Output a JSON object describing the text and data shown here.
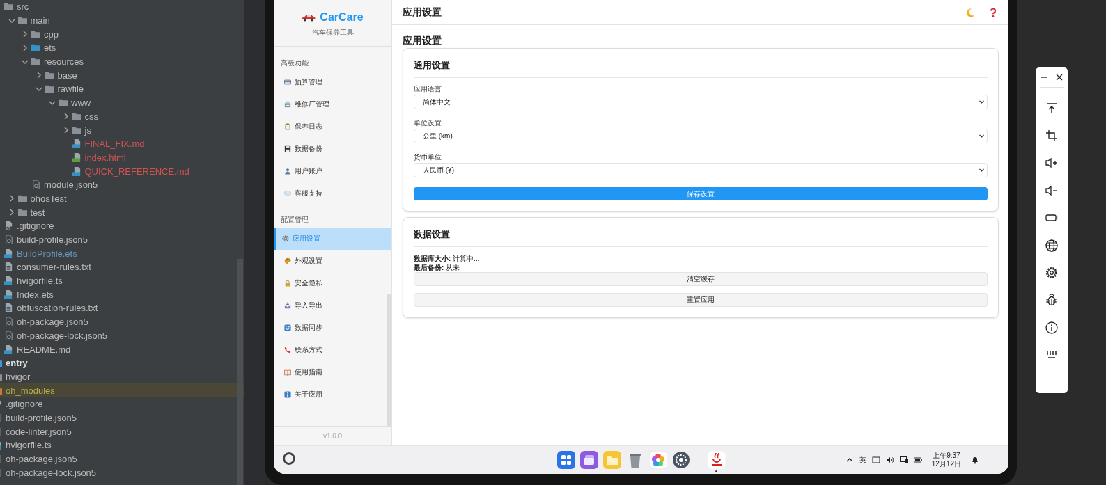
{
  "tree": {
    "module_files": [
      {
        "name": "src",
        "kind": "folder",
        "children": [
          {
            "name": "main",
            "kind": "folder",
            "expanded": true,
            "children": [
              {
                "name": "cpp",
                "kind": "folder",
                "expanded": false
              },
              {
                "name": "ets",
                "kind": "source_folder",
                "expanded": false
              },
              {
                "name": "resources",
                "kind": "folder",
                "expanded": true,
                "children": [
                  {
                    "name": "base",
                    "kind": "folder",
                    "expanded": false
                  },
                  {
                    "name": "rawfile",
                    "kind": "folder",
                    "expanded": true,
                    "children": [
                      {
                        "name": "www",
                        "kind": "folder",
                        "expanded": true,
                        "children": [
                          {
                            "name": "css",
                            "kind": "folder",
                            "expanded": false
                          },
                          {
                            "name": "js",
                            "kind": "folder",
                            "expanded": false
                          },
                          {
                            "name": "FINAL_FIX.md",
                            "kind": "md",
                            "color": "#d25252"
                          },
                          {
                            "name": "index.html",
                            "kind": "html",
                            "color": "#d25252"
                          },
                          {
                            "name": "QUICK_REFERENCE.md",
                            "kind": "md",
                            "color": "#d25252"
                          }
                        ]
                      }
                    ]
                  }
                ]
              },
              {
                "name": "module.json5",
                "kind": "json"
              }
            ]
          },
          {
            "name": "ohosTest",
            "kind": "folder",
            "expanded": false
          },
          {
            "name": "test",
            "kind": "folder",
            "expanded": false
          }
        ]
      },
      {
        "name": ".gitignore",
        "kind": "gitignore"
      },
      {
        "name": "build-profile.json5",
        "kind": "json"
      },
      {
        "name": "BuildProfile.ets",
        "kind": "ets",
        "color": "#6897bb"
      },
      {
        "name": "consumer-rules.txt",
        "kind": "txt"
      },
      {
        "name": "hvigorfile.ts",
        "kind": "ts"
      },
      {
        "name": "Index.ets",
        "kind": "ets"
      },
      {
        "name": "obfuscation-rules.txt",
        "kind": "txt"
      },
      {
        "name": "oh-package.json5",
        "kind": "json"
      },
      {
        "name": "oh-package-lock.json5",
        "kind": "json"
      },
      {
        "name": "README.md",
        "kind": "md"
      }
    ],
    "root_files": [
      {
        "name": "entry",
        "kind": "module",
        "highlighted": false
      },
      {
        "name": "hvigor",
        "kind": "folder",
        "highlighted": false
      },
      {
        "name": "oh_modules",
        "kind": "excluded_folder",
        "color": "#b5b04a",
        "highlighted": true
      },
      {
        "name": ".gitignore",
        "kind": "gitignore",
        "highlighted": false
      },
      {
        "name": "build-profile.json5",
        "kind": "json",
        "highlighted": false
      },
      {
        "name": "code-linter.json5",
        "kind": "json",
        "highlighted": false
      },
      {
        "name": "hvigorfile.ts",
        "kind": "ts",
        "highlighted": false
      },
      {
        "name": "oh-package.json5",
        "kind": "json",
        "highlighted": false
      },
      {
        "name": "oh-package-lock.json5",
        "kind": "json",
        "highlighted": false
      }
    ]
  },
  "app": {
    "logo": {
      "name": "CarCare",
      "subtitle": "汽车保养工具"
    },
    "sidebar": {
      "sections": [
        {
          "title": "高级功能",
          "items": [
            {
              "label": "预算管理",
              "selected": false
            },
            {
              "label": "维修厂管理",
              "selected": false
            },
            {
              "label": "保养日志",
              "selected": false
            },
            {
              "label": "数据备份",
              "selected": false
            },
            {
              "label": "用户账户",
              "selected": false
            },
            {
              "label": "客服支持",
              "selected": false
            }
          ]
        },
        {
          "title": "配置管理",
          "items": [
            {
              "label": "应用设置",
              "selected": true
            },
            {
              "label": "外观设置",
              "selected": false
            },
            {
              "label": "安全隐私",
              "selected": false
            },
            {
              "label": "导入导出",
              "selected": false
            },
            {
              "label": "数据同步",
              "selected": false
            },
            {
              "label": "联系方式",
              "selected": false
            },
            {
              "label": "使用指南",
              "selected": false
            },
            {
              "label": "关于应用",
              "selected": false
            }
          ]
        }
      ],
      "version": "v1.0.0"
    },
    "header": {
      "title": "应用设置"
    },
    "page_title": "应用设置",
    "cards": [
      {
        "title": "通用设置",
        "fields": [
          {
            "label": "应用语言",
            "value": "简体中文"
          },
          {
            "label": "单位设置",
            "value": "公里 (km)"
          },
          {
            "label": "货币单位",
            "value": "人民币 (¥)"
          }
        ],
        "buttons": [
          {
            "label": "保存设置",
            "kind": "primary"
          }
        ]
      },
      {
        "title": "数据设置",
        "info": [
          "**数据库大小:** 计算中...",
          "**最后备份:** 从未"
        ],
        "buttons": [
          {
            "label": "清空缓存",
            "kind": "secondary"
          },
          {
            "label": "重置应用",
            "kind": "secondary"
          }
        ]
      }
    ]
  },
  "taskbar": {
    "dock": [
      {
        "kind": "launcher",
        "running": false
      },
      {
        "kind": "multitask",
        "running": false
      },
      {
        "kind": "files",
        "running": false
      },
      {
        "kind": "trash",
        "running": false
      },
      {
        "kind": "gallery",
        "running": false
      },
      {
        "kind": "settings",
        "running": false
      },
      {
        "kind": "separator"
      },
      {
        "kind": "app",
        "running": true
      }
    ],
    "input_method": "英",
    "time": "上午9:37",
    "date": "12月12日"
  }
}
